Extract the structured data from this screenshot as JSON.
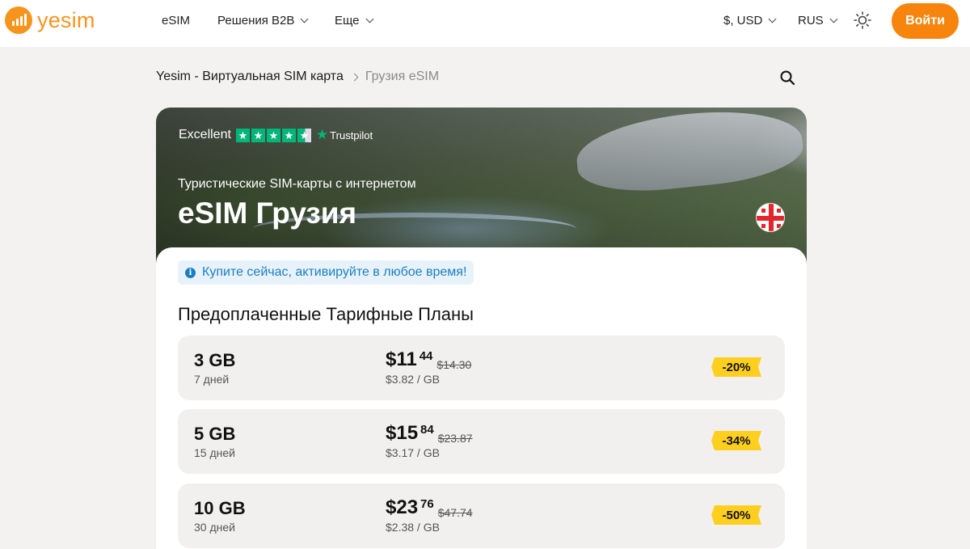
{
  "header": {
    "logo_text": "yesim",
    "nav": [
      {
        "label": "eSIM"
      },
      {
        "label": "Решения B2B"
      },
      {
        "label": "Еще"
      }
    ],
    "currency": "$, USD",
    "language": "RUS",
    "login_label": "Войти",
    "accent_color": "#f7850d"
  },
  "breadcrumb": {
    "home": "Yesim - Виртуальная SIM карта",
    "current": "Грузия eSIM"
  },
  "hero": {
    "rating_label": "Excellent",
    "rating_stars": 4.5,
    "rating_brand": "Trustpilot",
    "subtitle": "Туристические SIM-карты с интернетом",
    "title": "eSIM Грузия"
  },
  "notice": "Купите сейчас, активируйте в любое время!",
  "section_title": "Предоплаченные Тарифные Планы",
  "plans": [
    {
      "data": "3 GB",
      "days": "7 дней",
      "price": "$11",
      "cents": "44",
      "old_price": "$14.30",
      "per_gb": "$3.82 / GB",
      "discount": "-20%"
    },
    {
      "data": "5 GB",
      "days": "15 дней",
      "price": "$15",
      "cents": "84",
      "old_price": "$23.87",
      "per_gb": "$3.17 / GB",
      "discount": "-34%"
    },
    {
      "data": "10 GB",
      "days": "30 дней",
      "price": "$23",
      "cents": "76",
      "old_price": "$47.74",
      "per_gb": "$2.38 / GB",
      "discount": "-50%"
    }
  ]
}
